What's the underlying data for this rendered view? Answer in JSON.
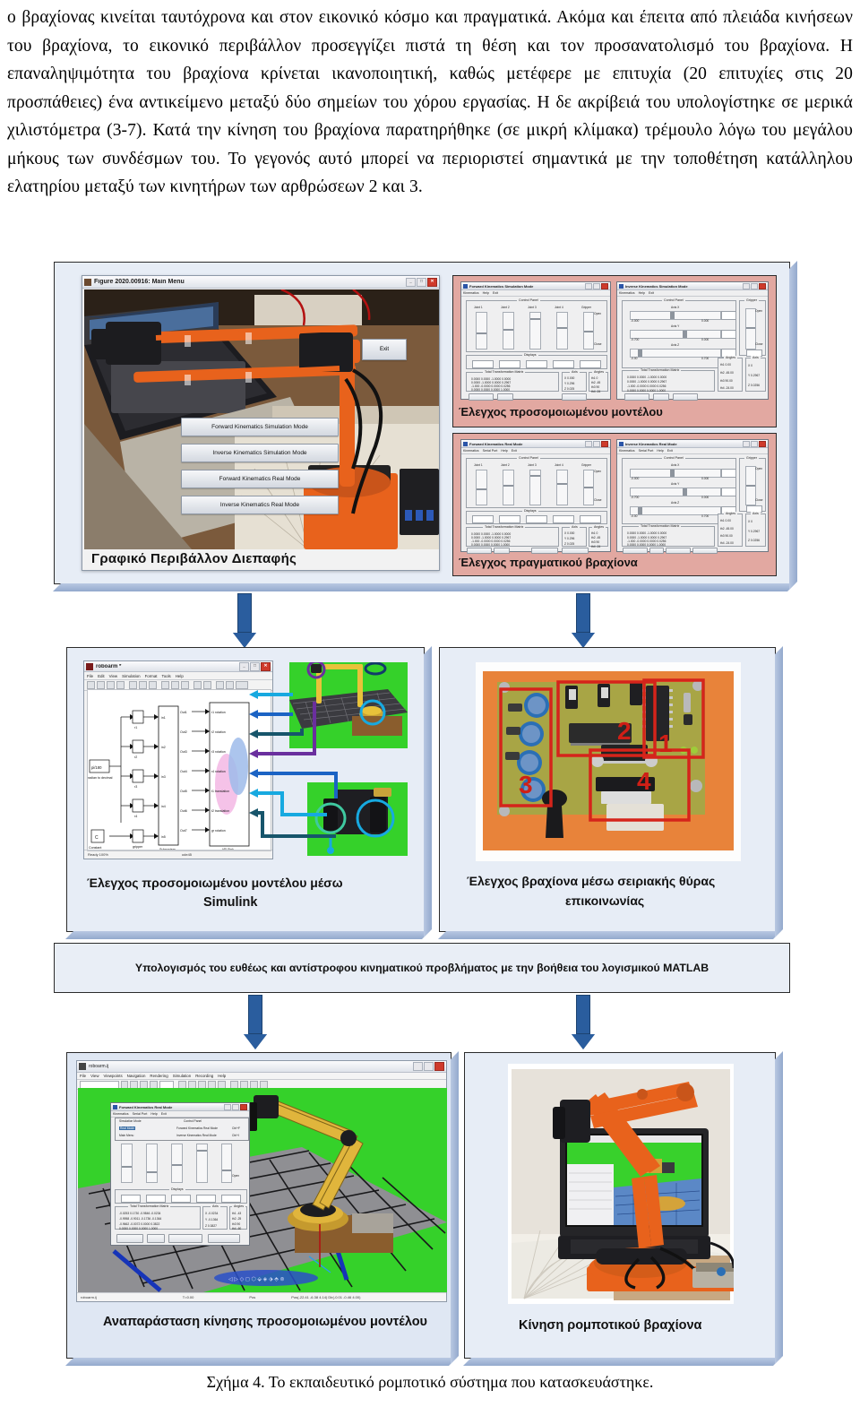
{
  "paragraph": "ο βραχίονας κινείται ταυτόχρονα και στον εικονικό κόσμο και πραγματικά. Ακόμα και έπειτα από πλειάδα κινήσεων του βραχίονα, το εικονικό περιβάλλον προσεγγίζει πιστά τη θέση και τον προσανατολισμό του βραχίονα. Η επαναληψιμότητα του βραχίονα κρίνεται ικανοποιητική, καθώς μετέφερε με επιτυχία (20 επιτυχίες στις 20 προσπάθειες) ένα αντικείμενο μεταξύ δύο σημείων του χόρου εργασίας. Η δε ακρίβειά του υπολογίστηκε σε μερικά χιλιστόμετρα (3-7). Κατά την κίνηση του βραχίονα παρατηρήθηκε (σε μικρή κλίμακα) τρέμουλο λόγω του μεγάλου μήκους των συνδέσμων του. Το γεγονός αυτό μπορεί να περιοριστεί σημαντικά με την τοποθέτηση κατάλληλου ελατηρίου μεταξύ των κινητήρων των αρθρώσεων 2 και 3.",
  "figure_caption": "Σχήμα 4. Το εκπαιδευτικό ρομποτικό σύστημα που κατασκευάστηκε.",
  "colors": {
    "arrow_blue": "#2a5d9e",
    "plate_fill": "#e7edf6",
    "pink_panel": "#e2a8a1",
    "robot_orange": "#e8621c",
    "pcb_board": "#e8833a",
    "pcb_highlight": "#d5241b",
    "vr_green": "#35d12a"
  },
  "gui_main": {
    "window_title": "Figure 2020.00916: Main Menu",
    "window_icon": "matlab-icon",
    "buttons": [
      "Forward Kinematics Simulation Mode",
      "Inverse Kinematics Simulation Mode",
      "Forward Kinematics Real Mode",
      "Inverse Kinematics Real Mode"
    ],
    "exit_button": "Exit",
    "caption": "Γραφικό Περιβάλλον Διεπαφής",
    "titlebar_buttons": [
      "_",
      "□",
      "✕"
    ]
  },
  "sim_group": {
    "caption": "Έλεγχος προσομοιωμένου μοντέλου",
    "windows": [
      {
        "title": "Forward Kinematics Simulation Mode",
        "menu": [
          "Kinematics",
          "Help",
          "Exit"
        ],
        "panel_title": "Control Panel",
        "slider_labels": [
          "Joint 1",
          "Joint 2",
          "Joint 3",
          "Joint 4",
          "Gripper"
        ],
        "gripper_open": "Open",
        "gripper_close": "Close",
        "displays_label": "Displays",
        "display_values": [
          "0",
          "-45",
          "90",
          "-24",
          "0"
        ],
        "matrix_label": "Total Transformation Matrix",
        "matrix": [
          [
            "0.0000",
            "0.0000",
            "-1.0000",
            "0.0000"
          ],
          [
            "0.0000",
            "-1.0000",
            "0.0000",
            "0.2967"
          ],
          [
            "-1.0000",
            "-0.0000",
            "0.0000",
            "0.0256"
          ],
          [
            "0.0000",
            "0.0000",
            "0.0000",
            "1.0000"
          ]
        ],
        "axis_label": "Axis",
        "axis_rows": [
          [
            "X",
            "0.0000"
          ],
          [
            "Y",
            "0.2967"
          ],
          [
            "Z",
            "0.0256"
          ]
        ],
        "angles_label": "Angles",
        "angle_rows": [
          [
            "th1",
            "0"
          ],
          [
            "th2",
            "-45"
          ],
          [
            "th3",
            "90"
          ],
          [
            "th4",
            "-24"
          ]
        ],
        "buttons": [
          "Simulate!",
          "Exit",
          "Start point"
        ]
      },
      {
        "title": "Inverse Kinematics Simulation Mode",
        "menu": [
          "Kinematics",
          "Help",
          "Exit"
        ],
        "panel_title": "Control Panel",
        "axis_sliders": [
          {
            "label": "Axis X",
            "min": "-0.000",
            "max": "0.000",
            "value": "0"
          },
          {
            "label": "Axis Y",
            "min": "-0.700",
            "max": "0.000",
            "value": "0.2967"
          },
          {
            "label": "Axis Z",
            "min": "-0.00",
            "max": "0.700",
            "value": "0.0256"
          }
        ],
        "gripper_label": "Gripper",
        "gripper_open": "Open",
        "gripper_close": "Close",
        "gripper_value": "0",
        "matrix_label": "Total Transformation Matrix",
        "matrix": [
          [
            "0.0000",
            "0.0000",
            "-1.0000",
            "0.0000"
          ],
          [
            "0.0000",
            "-1.0000",
            "0.0000",
            "0.2967"
          ],
          [
            "-1.0000",
            "-0.0000",
            "0.0000",
            "0.0256"
          ],
          [
            "0.0000",
            "0.0000",
            "0.0000",
            "1.0000"
          ]
        ],
        "angles_label": "Angles",
        "angle_rows": [
          [
            "th1",
            "0.00"
          ],
          [
            "th2",
            "-45.00"
          ],
          [
            "th3",
            "90.00"
          ],
          [
            "th4",
            "-24.00"
          ]
        ],
        "axis_label": "Axis",
        "axis_rows": [
          [
            "X",
            "0"
          ],
          [
            "Y",
            "0.2967"
          ],
          [
            "Z",
            "0.0256"
          ]
        ],
        "buttons": [
          "Simulate!",
          "Exit",
          "Start point"
        ]
      }
    ]
  },
  "real_group": {
    "caption": "Έλεγχος πραγματικού βραχίονα",
    "windows": [
      {
        "title": "Forward Kinematics Real Mode",
        "menu": [
          "Kinematics",
          "Serial Port",
          "Help",
          "Exit"
        ],
        "panel_title": "Control Panel",
        "slider_labels": [
          "Joint 1",
          "Joint 2",
          "Joint 3",
          "Joint 4",
          "Gripper"
        ],
        "gripper_open": "Open",
        "gripper_close": "Close",
        "displays_label": "Displays",
        "display_values": [
          "0",
          "-45",
          "90",
          "-24",
          "0"
        ],
        "matrix_label": "Total Transformation Matrix",
        "matrix": [
          [
            "0.0000",
            "0.0000",
            "-1.0000",
            "0.0000"
          ],
          [
            "0.0000",
            "-1.0000",
            "0.0000",
            "0.2967"
          ],
          [
            "-1.0000",
            "-0.0000",
            "0.0000",
            "0.0256"
          ],
          [
            "0.0000",
            "0.0000",
            "0.0000",
            "1.0000"
          ]
        ],
        "axis_label": "Axis",
        "axis_rows": [
          [
            "X",
            "0.0000"
          ],
          [
            "Y",
            "0.2967"
          ],
          [
            "Z",
            "0.0256"
          ]
        ],
        "angles_label": "Angles",
        "angle_rows": [
          [
            "th1",
            "0"
          ],
          [
            "th2",
            "-45"
          ],
          [
            "th3",
            "90"
          ],
          [
            "th4",
            "-24"
          ]
        ],
        "buttons": [
          "Simulate!",
          "Exit",
          "Move Real!",
          "Start point"
        ]
      },
      {
        "title": "Inverse Kinematics Real Mode",
        "menu": [
          "Kinematics",
          "Serial Port",
          "Help",
          "Exit"
        ],
        "panel_title": "Control Panel",
        "axis_sliders": [
          {
            "label": "Axis X",
            "min": "-0.000",
            "max": "0.000",
            "value": "0"
          },
          {
            "label": "Axis Y",
            "min": "-0.700",
            "max": "0.000",
            "value": "0.2967"
          },
          {
            "label": "Axis Z",
            "min": "-0.00",
            "max": "0.700",
            "value": "0.0256"
          }
        ],
        "gripper_label": "Gripper",
        "gripper_open": "Open",
        "gripper_close": "Close",
        "gripper_value": "0",
        "matrix_label": "Total Transformation Matrix",
        "matrix": [
          [
            "0.0000",
            "0.0000",
            "-1.0000",
            "0.0000"
          ],
          [
            "0.0000",
            "-1.0000",
            "0.0000",
            "0.2967"
          ],
          [
            "-1.0000",
            "-0.0000",
            "0.0000",
            "0.0256"
          ],
          [
            "0.0000",
            "0.0000",
            "0.0000",
            "1.0000"
          ]
        ],
        "angles_label": "Angles",
        "angle_rows": [
          [
            "th1",
            "0.00"
          ],
          [
            "th2",
            "-45.00"
          ],
          [
            "th3",
            "90.00"
          ],
          [
            "th4",
            "-24.00"
          ]
        ],
        "axis_label": "Axis",
        "axis_rows": [
          [
            "X",
            "0"
          ],
          [
            "Y",
            "0.2967"
          ],
          [
            "Z",
            "0.0256"
          ]
        ],
        "buttons": [
          "Simulate!",
          "Exit",
          "Start point",
          "Move Real!"
        ]
      }
    ]
  },
  "simulink": {
    "window_title": "roboarm *",
    "window_icon": "simulink-icon",
    "menu": [
      "File",
      "Edit",
      "View",
      "Simulation",
      "Format",
      "Tools",
      "Help"
    ],
    "status_left": "Ready 100%",
    "status_right": "ode45",
    "blocks_left": [
      "radian to decimal",
      "Constant",
      "gripper"
    ],
    "gain_blocks": [
      "r1",
      "r2",
      "r3",
      "r4"
    ],
    "in_ports": [
      "in1",
      "in2",
      "in3",
      "in4",
      "in5"
    ],
    "subsystem_label": "Subsystem",
    "vr_sink_label": "VR Sink",
    "out_ports": [
      "Out1",
      "Out2",
      "Out3",
      "Out4",
      "Out5",
      "Out6",
      "Out7"
    ],
    "vr_inputs": [
      "r1 rotation",
      "r2 rotation",
      "r3 rotation",
      "r4 rotation",
      "t1 translation",
      "t2 translation",
      "gr rotation"
    ],
    "caption_line1": "Έλεγχος προσομοιωμένου μοντέλου μέσω",
    "caption_line2": "Simulink"
  },
  "pcb": {
    "caption_line1": "Έλεγχος βραχίονα μέσω σειριακής θύρας",
    "caption_line2": "επικοινωνίας",
    "region_labels": [
      "1",
      "2",
      "3",
      "4"
    ]
  },
  "matlab_band": {
    "text": "Υπολογισμός του ευθέως και αντίστροφου κινηματικού προβλήματος με την βοήθεια του λογισμικού MATLAB"
  },
  "vr_panel": {
    "caption": "Αναπαράσταση κίνησης προσομοιωμένου μοντέλου",
    "toolbar_dropdown": "roboarm.ij",
    "status_items": [
      "roboarm.ij",
      "T=0.00",
      "Pos",
      "Pos(-22.41 -6.38 4.14) Dir(-0.01 -0.46 4.00)"
    ],
    "embedded_window_title": "Forward Kinematics Real Mode",
    "embedded_menu": [
      "Kinematics",
      "Serial Port",
      "Help",
      "Exit"
    ],
    "embedded_menu_items": [
      "Simulation Mode",
      "Real Mode",
      "Main Menu",
      "Forward Kinematics Real Mode",
      "Inverse Kinematics Real Mode"
    ],
    "embedded_shortcuts": [
      "Ctrl+F",
      "Ctrl+I"
    ],
    "embedded_panel_title": "Control Panel",
    "display_values": [
      "-43",
      "-25",
      "90",
      "-60",
      "0"
    ],
    "matrix": [
      [
        "-0.0253",
        "0.1730",
        "-0.9846",
        "-0.0234"
      ],
      [
        "-0.9958",
        "-0.9011",
        "-0.1736",
        "-0.1364"
      ],
      [
        "-0.9662",
        "-0.0072",
        "0.0000",
        "0.3822"
      ],
      [
        "0.0000",
        "0.0000",
        "0.0000",
        "1.0000"
      ]
    ],
    "axis_rows": [
      [
        "X",
        "-0.0234"
      ],
      [
        "Y",
        "-0.1364"
      ],
      [
        "Z",
        "0.3827"
      ]
    ],
    "angle_rows": [
      [
        "th1",
        "-43"
      ],
      [
        "th2",
        "-25"
      ],
      [
        "th3",
        "90"
      ],
      [
        "th4",
        "-60"
      ]
    ],
    "buttons": [
      "Simulate!",
      "Exit",
      "Move Real!",
      "Start point"
    ]
  },
  "arm_photo": {
    "caption": "Κίνηση ρομποτικού βραχίονα"
  },
  "arrows": {
    "down_icon": "arrow-down-icon",
    "count": 4
  }
}
